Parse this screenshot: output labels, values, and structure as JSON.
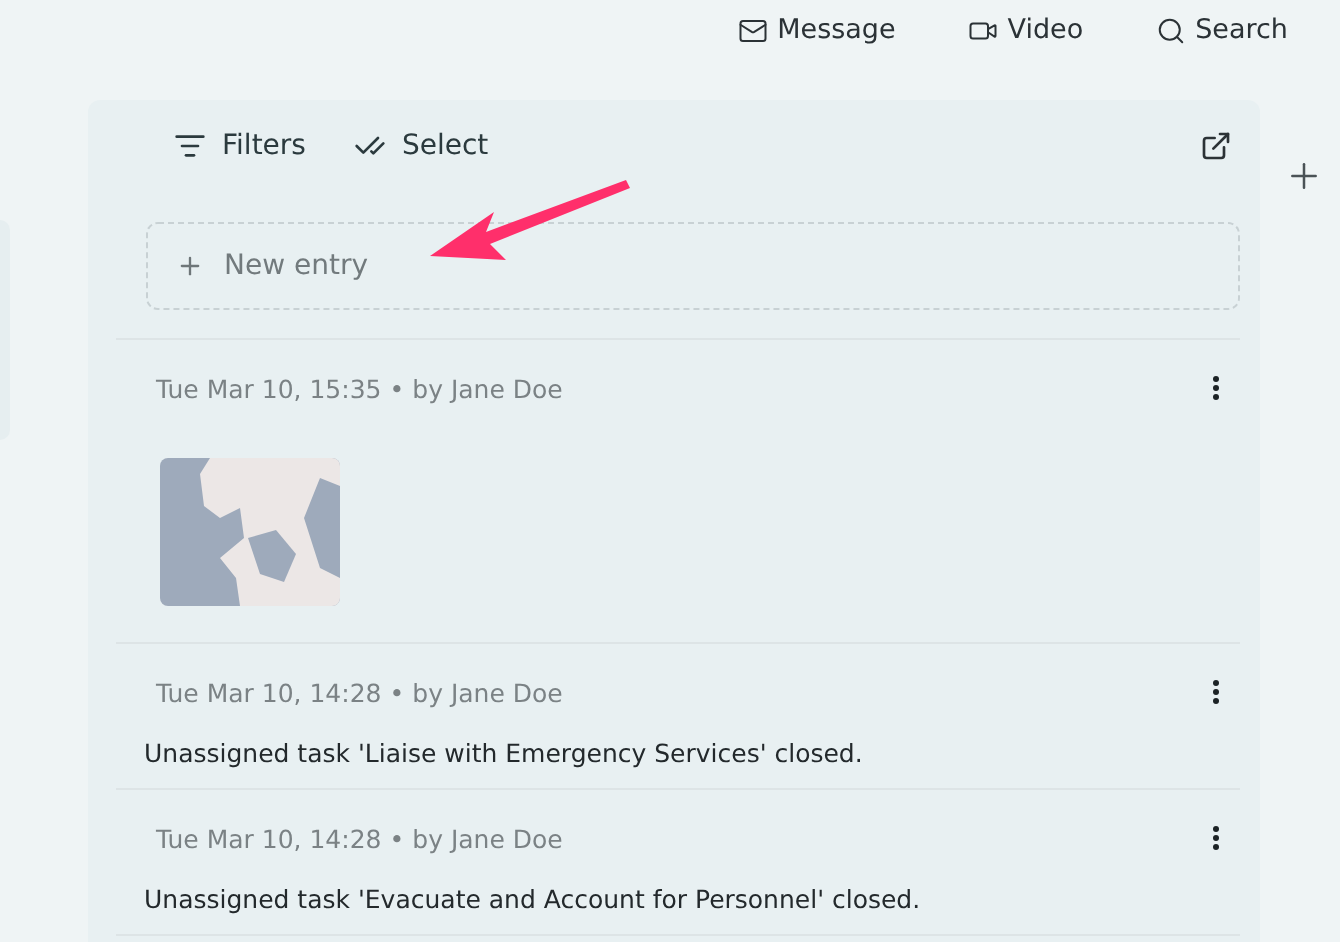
{
  "top_bar": {
    "actions": [
      {
        "kind": "message",
        "label": "Message"
      },
      {
        "kind": "video",
        "label": "Video"
      },
      {
        "kind": "search",
        "label": "Search"
      }
    ]
  },
  "toolbar": {
    "filters": "Filters",
    "select": "Select"
  },
  "new_entry": {
    "placeholder": "New entry"
  },
  "entries": [
    {
      "kind": "map",
      "time": "Tue Mar 10, 15:35",
      "separator": "•",
      "author": "by Jane Doe"
    },
    {
      "kind": "text",
      "time": "Tue Mar 10, 14:28",
      "separator": "•",
      "author": "by Jane Doe",
      "text": "Unassigned task 'Liaise with Emergency Services' closed."
    },
    {
      "kind": "text",
      "time": "Tue Mar 10, 14:28",
      "separator": "•",
      "author": "by Jane Doe",
      "text": "Unassigned task 'Evacuate and Account for Personnel' closed."
    }
  ]
}
